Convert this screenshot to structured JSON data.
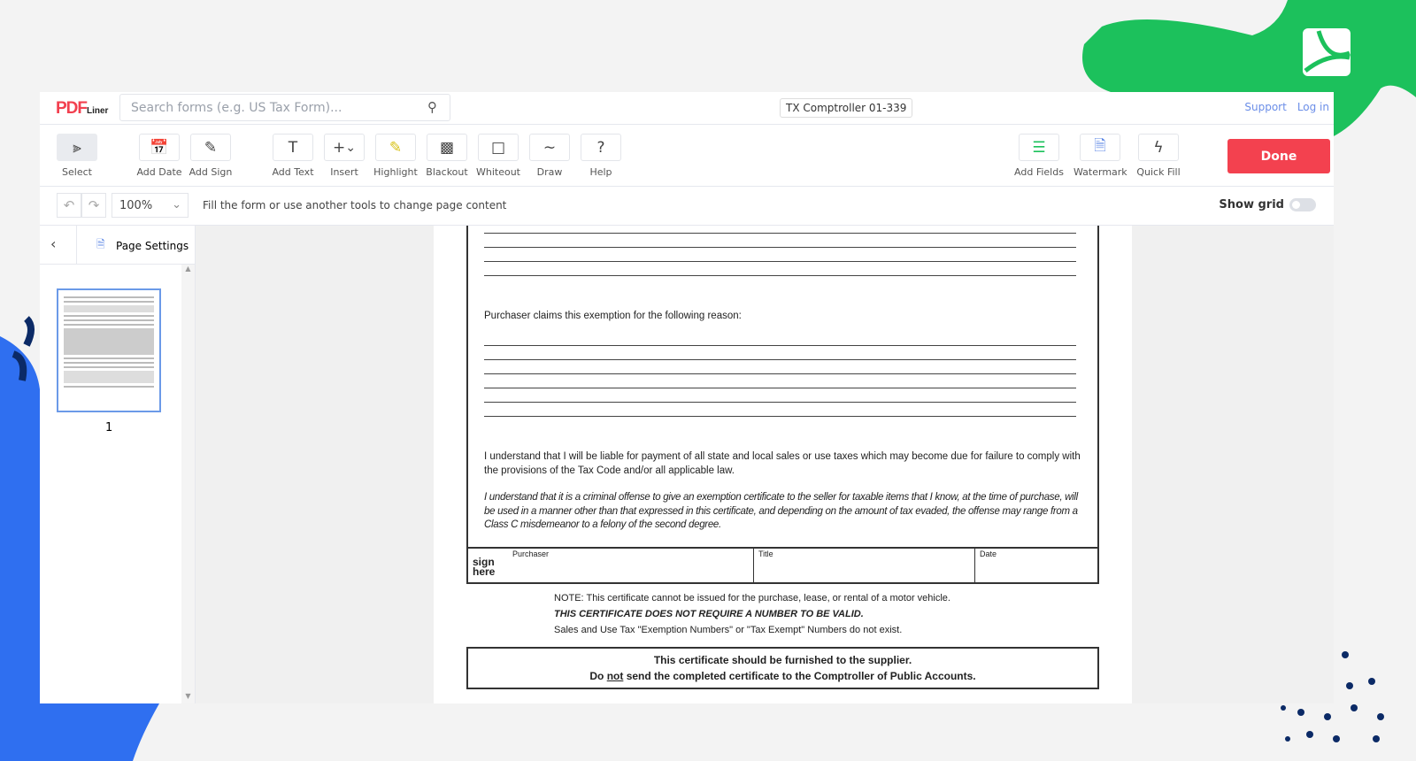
{
  "header": {
    "logo": "PDF",
    "logo_sub": "Liner",
    "search_placeholder": "Search forms (e.g. US Tax Form)...",
    "doc_title": "TX Comptroller 01-339",
    "support": "Support",
    "login": "Log in"
  },
  "toolbar": {
    "tools": [
      "Select",
      "Add Date",
      "Add Sign",
      "Add Text",
      "Insert",
      "Highlight",
      "Blackout",
      "Whiteout",
      "Draw",
      "Help"
    ],
    "right_tools": [
      "Add Fields",
      "Watermark",
      "Quick Fill"
    ],
    "done": "Done"
  },
  "subbar": {
    "zoom": "100%",
    "hint": "Fill the form or use another tools to change page content",
    "show_grid": "Show grid"
  },
  "sidebar": {
    "title": "Page Settings",
    "page_number": "1"
  },
  "document": {
    "reason_label": "Purchaser claims this exemption for the following reason:",
    "liability": "I understand that I will be liable for payment of all state and local sales or use taxes which may become due for failure to comply with the provisions of the Tax Code and/or all applicable law.",
    "criminal": "I understand that it is a criminal offense to give an exemption certificate to the seller for taxable items that I know, at the time of purchase, will be used in a manner other than that expressed in this certificate, and depending on the amount of tax evaded, the offense may range from a Class C misdemeanor to a felony of the second degree.",
    "sign_here": "sign here",
    "purchaser": "Purchaser",
    "title": "Title",
    "date": "Date",
    "note1": "NOTE:   This certificate cannot be issued for the purchase, lease, or rental of a motor vehicle.",
    "note2": "THIS CERTIFICATE DOES NOT REQUIRE A NUMBER TO BE VALID.",
    "note3": "Sales and Use Tax \"Exemption Numbers\" or \"Tax Exempt\" Numbers do not exist.",
    "box1": "This certificate should be furnished to the supplier.",
    "box2_pre": "Do ",
    "box2_not": "not",
    "box2_post": " send the completed certificate to the Comptroller of Public Accounts."
  },
  "colors": {
    "accent": "#f3414f",
    "brand_green": "#1cc15c",
    "link": "#6b8ee8",
    "blue_deco": "#2f6ff0"
  }
}
